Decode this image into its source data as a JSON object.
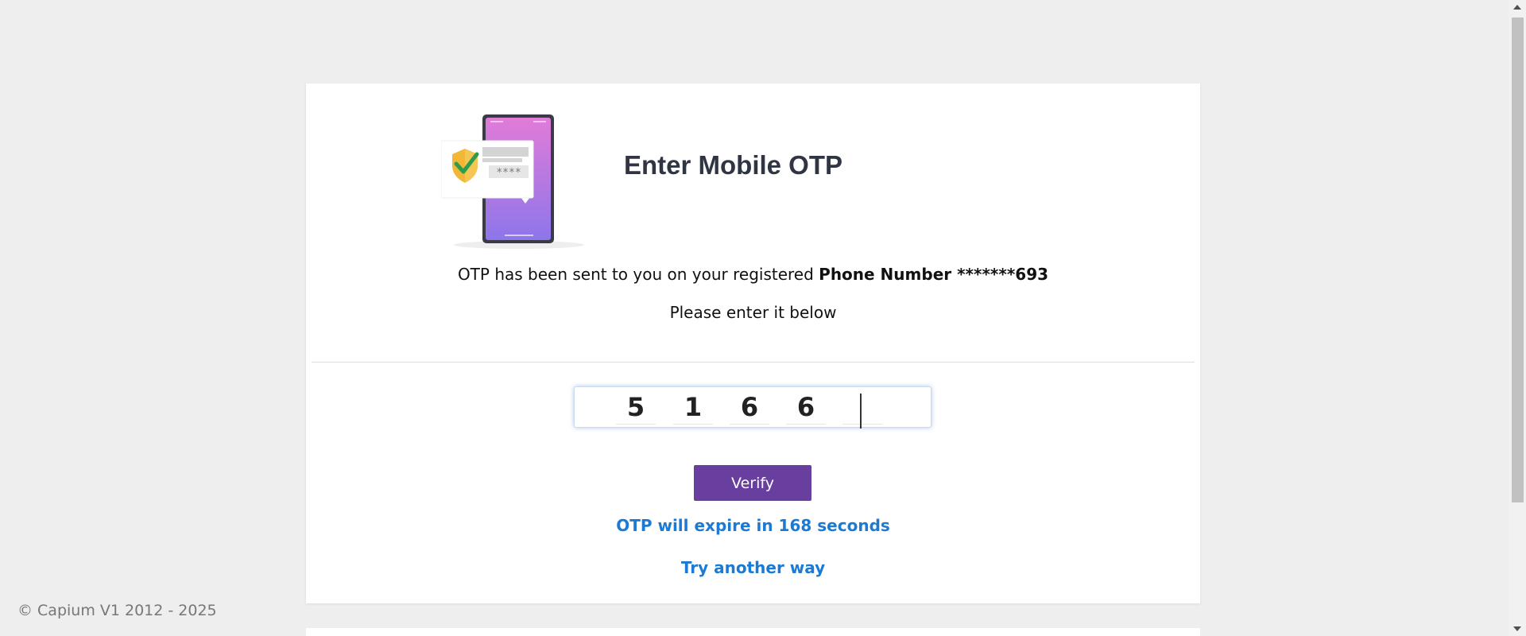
{
  "heading": {
    "title": "Enter Mobile OTP"
  },
  "illustration": {
    "icon": "phone-shield-otp-icon",
    "masked_code": "****",
    "phone_colors": [
      "#e17bd8",
      "#8d76ea"
    ],
    "shield_colors": [
      "#f2b734",
      "#2e9c4d"
    ]
  },
  "message": {
    "sent_prefix": "OTP has been sent to you on your registered ",
    "sent_bold": "Phone Number *******693",
    "enter_below": "Please enter it below"
  },
  "otp": {
    "digits": [
      "5",
      "1",
      "6",
      "6",
      ""
    ],
    "focus_color": "#6699dd"
  },
  "actions": {
    "verify_label": "Verify",
    "verify_color": "#683f9e",
    "expire_text": "OTP will expire in 168 seconds",
    "try_another": "Try another way",
    "link_color": "#1a7ad4"
  },
  "footer": {
    "copyright": "© Capium V1 2012 - 2025"
  }
}
